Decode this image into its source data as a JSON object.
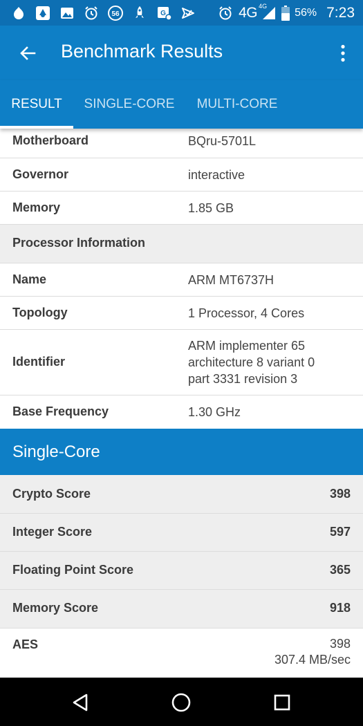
{
  "status_bar": {
    "notification_icons": [
      "android-icon",
      "debug-icon",
      "image-icon",
      "alarm-icon",
      "badge-56-icon",
      "rocket-icon",
      "gps-icon",
      "send-icon"
    ],
    "badge_number": "56",
    "network": "4G",
    "network_small": "4G",
    "battery_percent": "56%",
    "time": "7:23"
  },
  "toolbar": {
    "title": "Benchmark Results"
  },
  "tabs": [
    {
      "label": "RESULT",
      "active": true
    },
    {
      "label": "SINGLE-CORE",
      "active": false
    },
    {
      "label": "MULTI-CORE",
      "active": false
    }
  ],
  "system_info": [
    {
      "label": "Motherboard",
      "value": "BQru-5701L"
    },
    {
      "label": "Governor",
      "value": "interactive"
    },
    {
      "label": "Memory",
      "value": "1.85 GB"
    }
  ],
  "processor_header": "Processor Information",
  "processor_info": [
    {
      "label": "Name",
      "value": "ARM MT6737H"
    },
    {
      "label": "Topology",
      "value": "1 Processor, 4 Cores"
    },
    {
      "label": "Identifier",
      "value_lines": [
        "ARM implementer 65",
        "architecture 8 variant 0",
        "part 3331 revision 3"
      ]
    },
    {
      "label": "Base Frequency",
      "value": "1.30 GHz"
    }
  ],
  "single_core": {
    "header": "Single-Core",
    "scores": [
      {
        "label": "Crypto Score",
        "value": "398"
      },
      {
        "label": "Integer Score",
        "value": "597"
      },
      {
        "label": "Floating Point Score",
        "value": "365"
      },
      {
        "label": "Memory Score",
        "value": "918"
      }
    ],
    "aes": {
      "label": "AES",
      "score": "398",
      "throughput": "307.4 MB/sec"
    }
  },
  "colors": {
    "status_bar": "#0d6fb3",
    "app_bar": "#0e7fc6",
    "gray_row": "#eeeeee",
    "nav_bar": "#000000"
  }
}
